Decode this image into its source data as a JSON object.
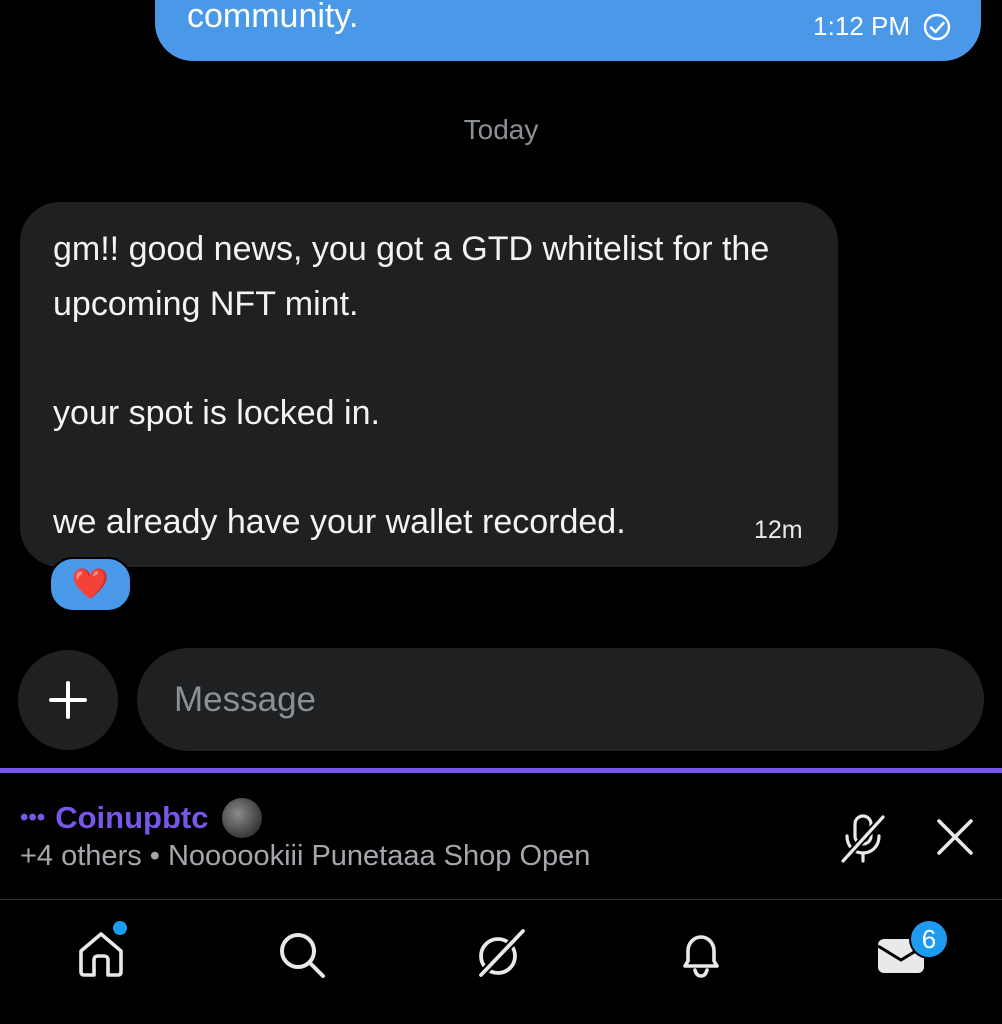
{
  "sent_message": {
    "text": "community.",
    "time": "1:12 PM",
    "status_icon": "read-check-icon"
  },
  "date_separator": "Today",
  "received_message": {
    "text": "gm!! good news, you got a GTD whitelist for the upcoming NFT mint.\n\nyour spot is locked in.\n\nwe already have your wallet recorded.",
    "time": "12m",
    "reaction": "❤️"
  },
  "composer": {
    "placeholder": "Message",
    "add_icon": "plus-icon"
  },
  "space": {
    "host": "Coinupbtc",
    "subtitle": "+4 others • Noooookiii Punetaaa Shop Open",
    "accent_color": "#7757e8",
    "mute_icon": "mic-off-icon",
    "close_icon": "close-icon"
  },
  "nav": {
    "items": [
      "home-icon",
      "search-icon",
      "grok-icon",
      "bell-icon",
      "mail-icon"
    ],
    "messages_badge": "6",
    "badge_color": "#1d9bf0"
  },
  "colors": {
    "sent_bubble": "#4a99e9",
    "received_bubble": "#1f2022",
    "background": "#000000"
  }
}
